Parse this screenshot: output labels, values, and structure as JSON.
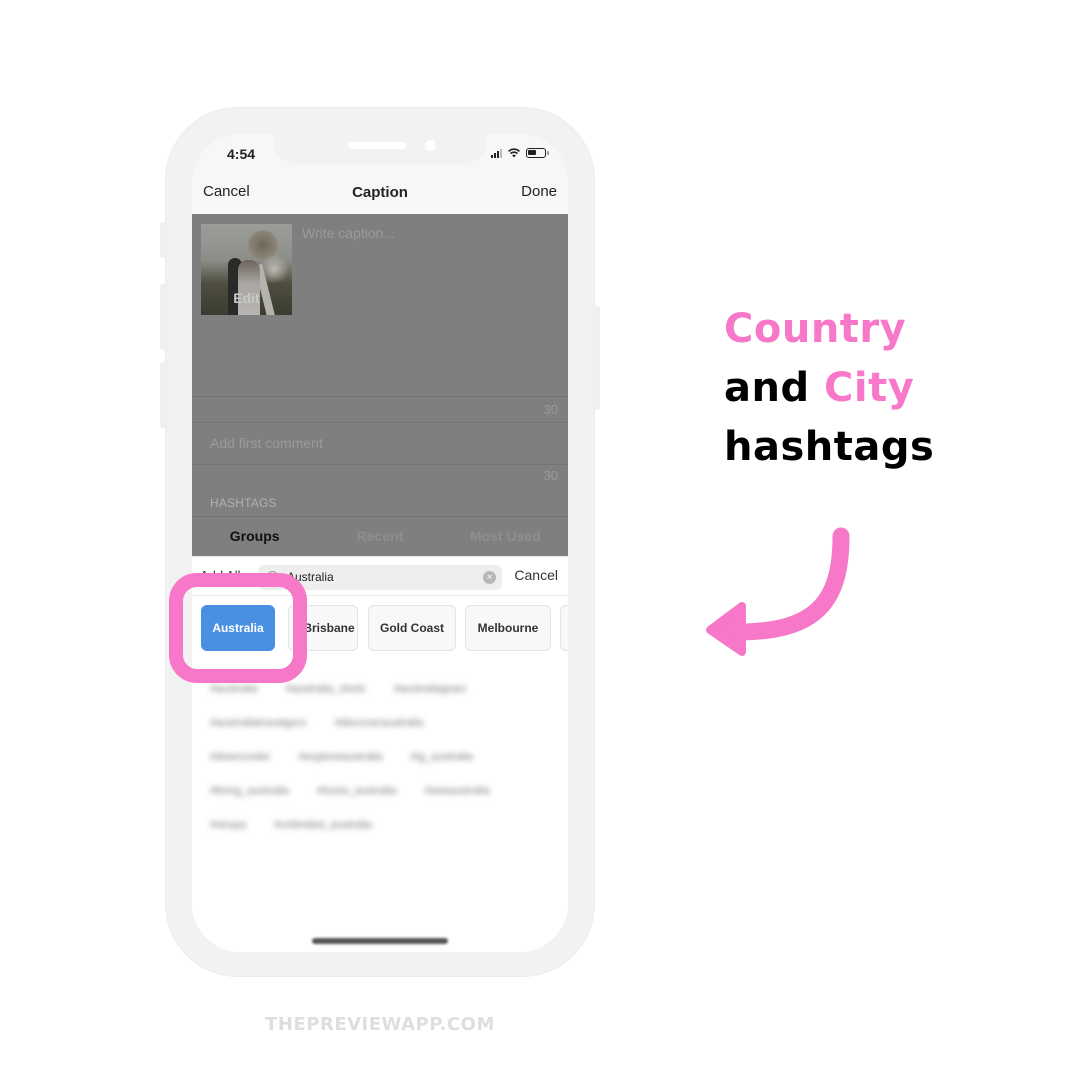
{
  "status_bar": {
    "time": "4:54",
    "icons": [
      "signal-icon",
      "wifi-icon",
      "battery-icon"
    ]
  },
  "nav": {
    "cancel_label": "Cancel",
    "title": "Caption",
    "done_label": "Done"
  },
  "caption": {
    "thumbnail_edit_label": "Edit",
    "placeholder": "Write caption...",
    "caption_remaining": "30",
    "first_comment_placeholder": "Add first comment",
    "comment_remaining": "30"
  },
  "hashtags": {
    "section_label": "HASHTAGS",
    "tabs": [
      {
        "label": "Groups",
        "active": true
      },
      {
        "label": "Recent",
        "active": false
      },
      {
        "label": "Most Used",
        "active": false
      }
    ],
    "add_all_label": "Add All",
    "search": {
      "value": "Australia",
      "cancel_label": "Cancel"
    },
    "groups": [
      {
        "label": "Australia",
        "selected": true
      },
      {
        "label": "Brisbane",
        "selected": false
      },
      {
        "label": "Gold Coast",
        "selected": false
      },
      {
        "label": "Melbourne",
        "selected": false
      },
      {
        "label": "",
        "selected": false
      }
    ],
    "blurred_tags": [
      [
        "#australia",
        "#australia_shotz",
        "#australiagram"
      ],
      [
        "#australiatravelguru",
        "#discoveraustralia"
      ],
      [
        "#downunder",
        "#exploreaustralia",
        "#ig_australia"
      ],
      [
        "#living_australia",
        "#loves_australia",
        "#seeaustralia"
      ],
      [
        "#straya",
        "#unlimited_australia"
      ]
    ]
  },
  "promo": {
    "headline_line1_pink": "Country",
    "headline_line2_black": "and",
    "headline_line2_pink": "City",
    "headline_line3_black": "hashtags",
    "accent_color": "#f777c8",
    "selected_chip_color": "#4a90e2"
  },
  "footer": {
    "brand": "THEPREVIEWAPP.COM"
  }
}
